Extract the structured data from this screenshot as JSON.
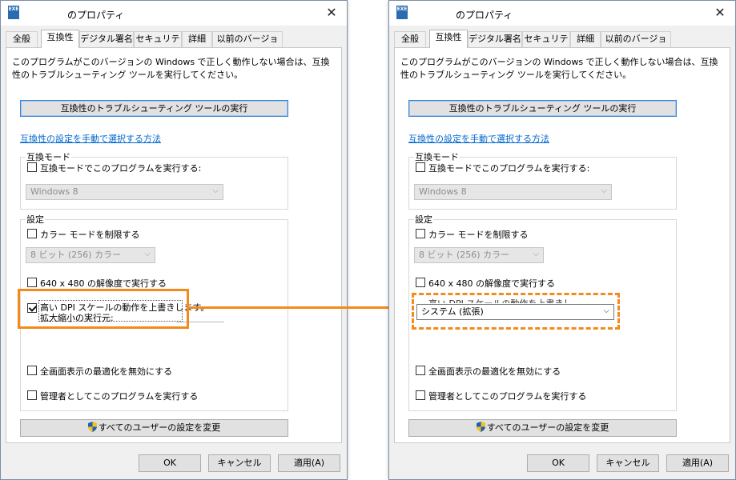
{
  "dialog": {
    "icon_text": "EXE",
    "title": "のプロパティ",
    "close_glyph": "✕",
    "tabs": [
      "全般",
      "互換性",
      "デジタル署名",
      "セキュリティ",
      "詳細",
      "以前のバージョン"
    ],
    "description": "このプログラムがこのバージョンの Windows で正しく動作しない場合は、互換性のトラブルシューティング ツールを実行してください。",
    "troubleshoot_button": "互換性のトラブルシューティング ツールの実行",
    "manual_link": "互換性の設定を手動で選択する方法",
    "compat_mode": {
      "group_label": "互換モード",
      "checkbox_label": "互換モードでこのプログラムを実行する:",
      "checked": false,
      "select_value": "Windows 8"
    },
    "settings": {
      "group_label": "設定",
      "color_mode": {
        "label": "カラー モードを制限する",
        "checked": false
      },
      "color_select": "8 ビット (256) カラー",
      "resolution": {
        "label": "640 x 480 の解像度で実行する",
        "checked": false
      },
      "high_dpi": {
        "label_line1": "高い DPI スケールの動作を上書きします。",
        "label_line2": "拡大縮小の実行元:",
        "checked": true
      },
      "high_dpi_select": "システム (拡張)",
      "fullscreen": {
        "label": "全画面表示の最適化を無効にする",
        "checked": false
      },
      "admin": {
        "label": "管理者としてこのプログラムを実行する",
        "checked": false
      }
    },
    "all_users_button": "すべてのユーザーの設定を変更",
    "ok_button": "OK",
    "cancel_button": "キャンセル",
    "apply_button": "適用(A)"
  },
  "colors": {
    "highlight": "#f28a1c",
    "link": "#0066cc",
    "focus_border": "#3a84d0"
  }
}
